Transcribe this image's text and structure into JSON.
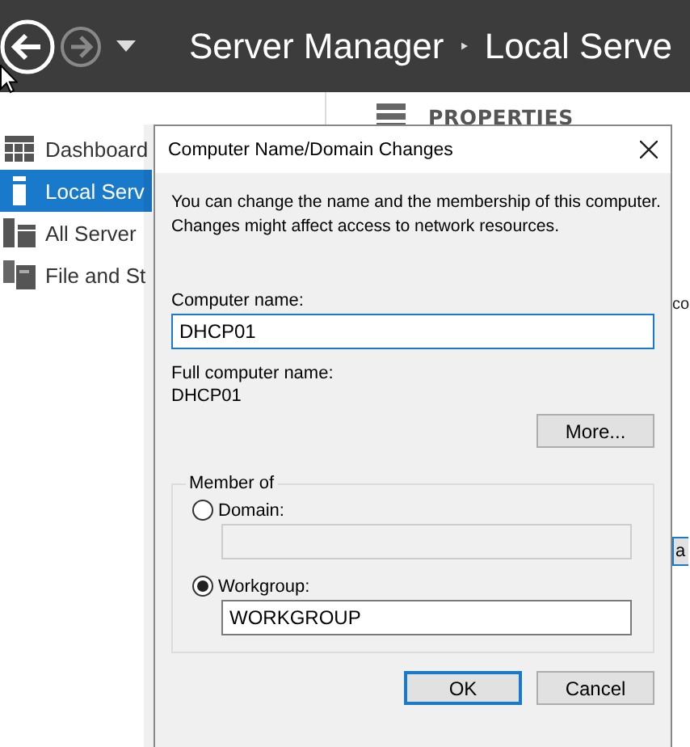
{
  "header": {
    "title": "Server Manager",
    "separator": "‣",
    "page": "Local Serve"
  },
  "sidebar": {
    "items": [
      {
        "label": "Dashboard",
        "kind": "dashboard",
        "selected": false
      },
      {
        "label": "Local Serv",
        "kind": "server",
        "selected": true
      },
      {
        "label": "All Server",
        "kind": "servers",
        "selected": false
      },
      {
        "label": "File and St",
        "kind": "files",
        "selected": false
      }
    ]
  },
  "content": {
    "heading": "PROPERTIES",
    "label_fragment": "co",
    "button_fragment": "a"
  },
  "dialog": {
    "title": "Computer Name/Domain Changes",
    "intro": "You can change the name and the membership of this computer. Changes might affect access to network resources.",
    "computer_name": {
      "label": "Computer name:",
      "value": "DHCP01",
      "focused": true
    },
    "full_name": {
      "label": "Full computer name:",
      "value": "DHCP01"
    },
    "more_button": "More...",
    "member_of": {
      "legend": "Member of",
      "options": [
        {
          "label": "Domain:",
          "selected": false
        },
        {
          "label": "Workgroup:",
          "selected": true,
          "value": "WORKGROUP"
        }
      ]
    },
    "buttons": [
      {
        "label": "OK",
        "default": true
      },
      {
        "label": "Cancel",
        "default": false
      }
    ]
  }
}
